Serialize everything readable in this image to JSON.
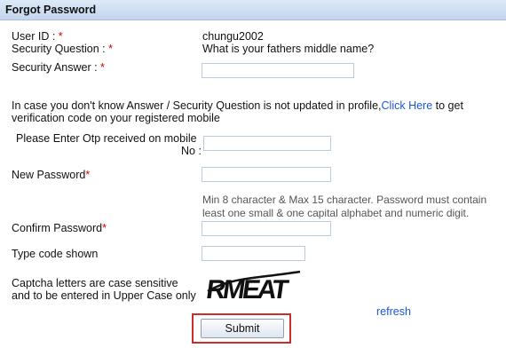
{
  "title": "Forgot Password",
  "user_id": {
    "label": "User ID",
    "sep": " : ",
    "req": "*",
    "value": "chungu2002"
  },
  "security_question": {
    "label": "Security Question",
    "sep": " : ",
    "req": "*",
    "value": "What is your fathers middle name?"
  },
  "security_answer": {
    "label": "Security Answer",
    "sep": " : ",
    "req": "*",
    "value": ""
  },
  "otp_info": {
    "line1_pre": "In case you don't know Answer / Security Question is not updated in profile,",
    "link": "Click Here",
    "line1_post": " to get",
    "line2": "verification code on your registered mobile"
  },
  "otp": {
    "label_line1": "Please Enter Otp received on mobile",
    "label_line2": "No :",
    "value": ""
  },
  "new_password": {
    "label": "New Password",
    "req": "*",
    "value": ""
  },
  "password_hint": {
    "line1": "Min 8 character & Max 15 character. Password must contain",
    "line2": "least one small & one capital alphabet and numeric digit."
  },
  "confirm_password": {
    "label": "Confirm Password",
    "req": "*",
    "value": ""
  },
  "captcha_input": {
    "label": "Type code shown",
    "value": ""
  },
  "captcha_note": {
    "line1": "Captcha letters are case sensitive",
    "line2": "and to be entered in Upper Case only"
  },
  "captcha_text": "RMEAT",
  "refresh_label": "refresh",
  "submit_label": "Submit"
}
